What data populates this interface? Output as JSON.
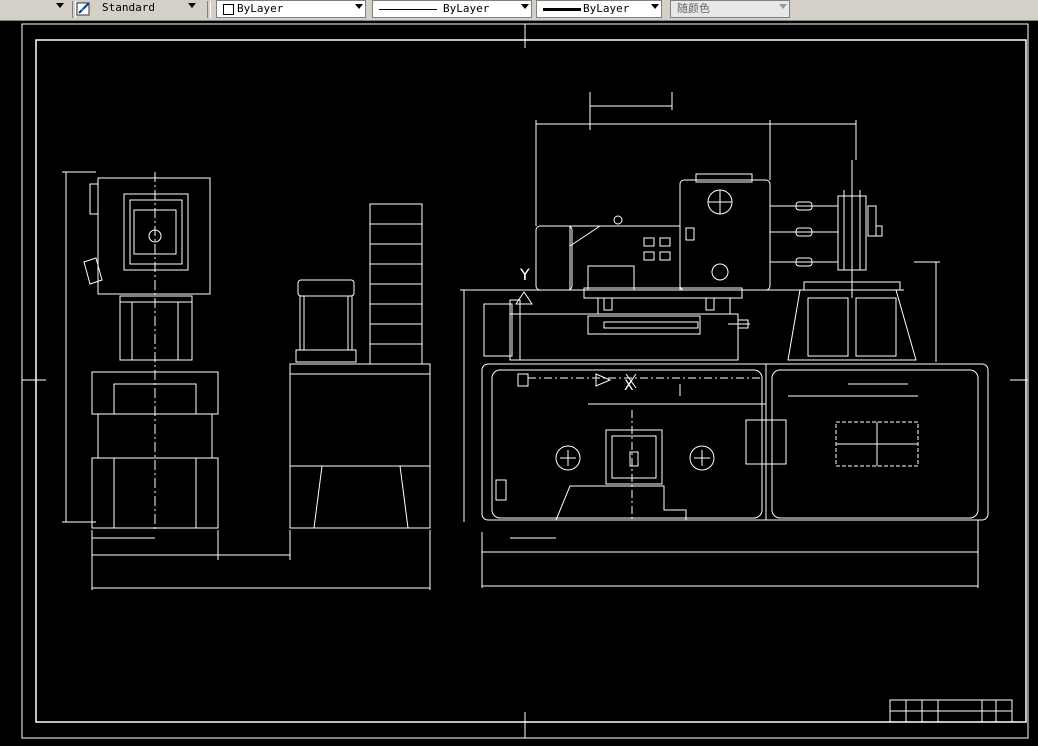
{
  "toolbar": {
    "text_style": "Standard",
    "layer": "ByLayer",
    "linetype": "ByLayer",
    "lineweight": "ByLayer",
    "color": "随颜色"
  },
  "drawing": {
    "labels": {
      "y_axis_marker": "Y",
      "x_axis_marker": "X"
    },
    "colors": {
      "background": "#000000",
      "lines": "#ffffff",
      "toolbar_bg": "#d4d0c8"
    }
  }
}
